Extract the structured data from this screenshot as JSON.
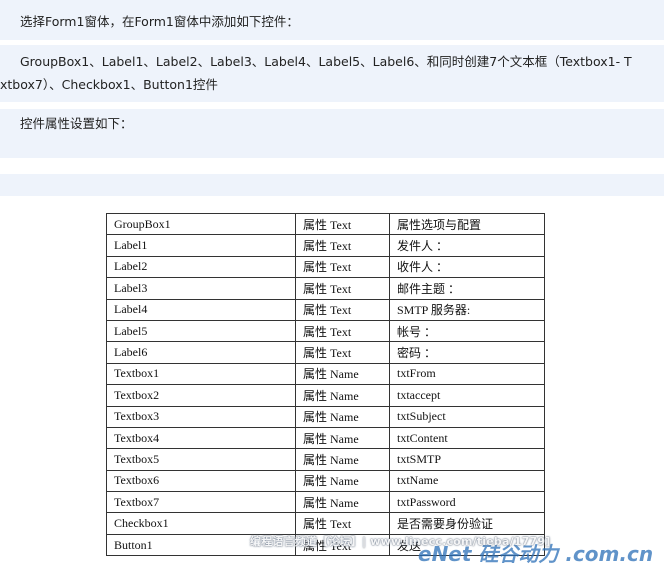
{
  "intro": {
    "line1": "选择Form1窗体，在Form1窗体中添加如下控件：",
    "line2a": "GroupBox1、Label1、Label2、Label3、Label4、Label5、Label6、和同时创建7个文本框（Textbox1- T",
    "line2b": "xtbox7）、Checkbox1、Button1控件",
    "line3": "控件属性设置如下："
  },
  "table": {
    "rows": [
      {
        "control": "GroupBox1",
        "prop": "属性 Text",
        "value": "属性选项与配置"
      },
      {
        "control": "Label1",
        "prop": "属性 Text",
        "value": "发件人 ："
      },
      {
        "control": "Label2",
        "prop": "属性 Text",
        "value": "收件人 ："
      },
      {
        "control": "Label3",
        "prop": "属性 Text",
        "value": "邮件主题 ："
      },
      {
        "control": "Label4",
        "prop": "属性 Text",
        "value": "SMTP 服务器:"
      },
      {
        "control": "Label5",
        "prop": "属性 Text",
        "value": "帐号 ："
      },
      {
        "control": "Label6",
        "prop": "属性 Text",
        "value": "密码 ："
      },
      {
        "control": "Textbox1",
        "prop": "属性 Name",
        "value": "txtFrom"
      },
      {
        "control": "Textbox2",
        "prop": "属性 Name",
        "value": "txtaccept"
      },
      {
        "control": "Textbox3",
        "prop": "属性 Name",
        "value": "txtSubject"
      },
      {
        "control": "Textbox4",
        "prop": "属性 Name",
        "value": "txtContent"
      },
      {
        "control": "Textbox5",
        "prop": "属性 Name",
        "value": "txtSMTP"
      },
      {
        "control": "Textbox6",
        "prop": "属性 Name",
        "value": "txtName"
      },
      {
        "control": "Textbox7",
        "prop": "属性 Name",
        "value": "txtPassword"
      },
      {
        "control": "Checkbox1",
        "prop": "属性 Text",
        "value": "是否需要身份验证"
      },
      {
        "control": "Button1",
        "prop": "属性 Text",
        "value": "发送"
      }
    ]
  },
  "watermark": {
    "text": "编程语言频道【论坛】| www.linecc.com/tieba/1779]",
    "logo": "eNet 硅谷动力 .com.cn"
  },
  "colors": {
    "band": "#eef3fb",
    "border": "#333333"
  }
}
